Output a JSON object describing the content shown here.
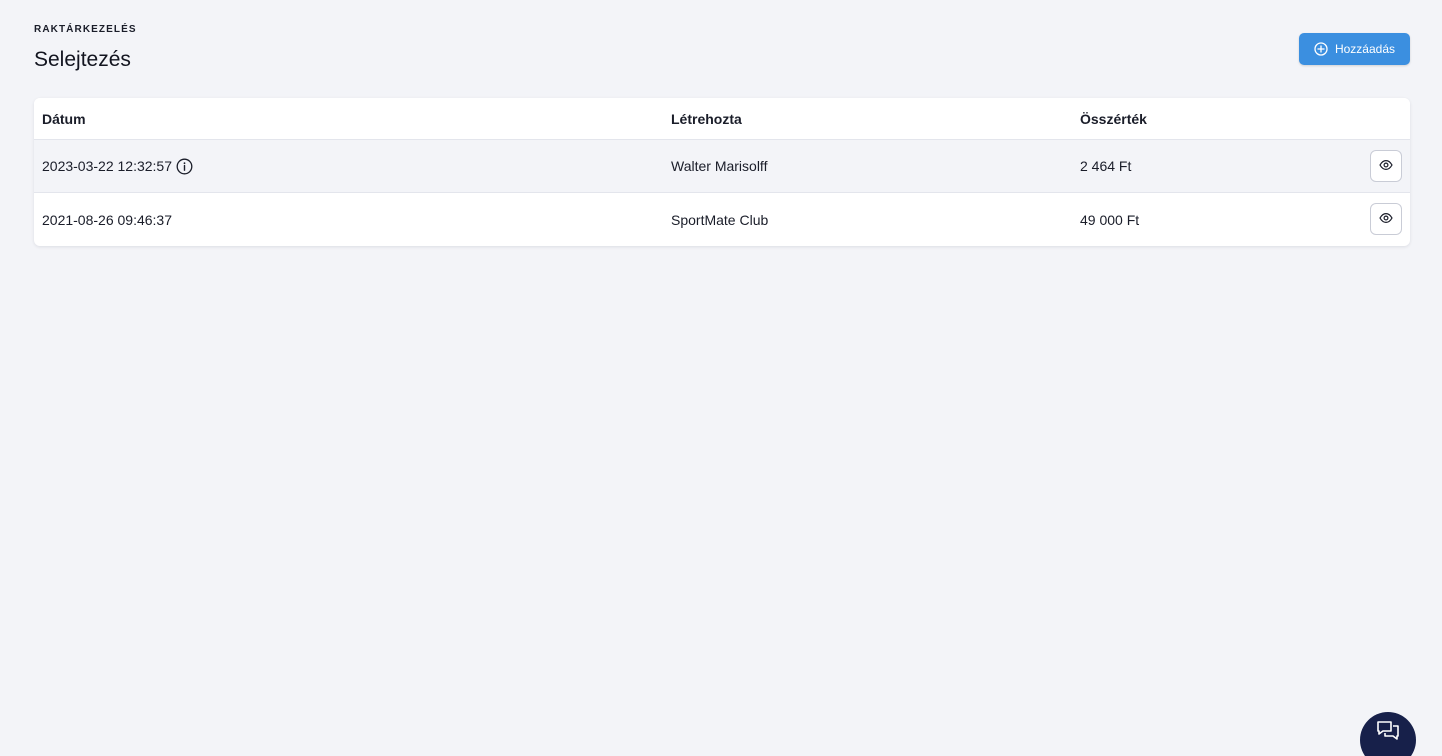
{
  "header": {
    "breadcrumb": "RAKTÁRKEZELÉS",
    "title": "Selejtezés"
  },
  "toolbar": {
    "add_label": "Hozzáadás"
  },
  "table": {
    "columns": {
      "date": "Dátum",
      "created_by": "Létrehozta",
      "total": "Összérték"
    },
    "rows": [
      {
        "date": "2023-03-22 12:32:57",
        "created_by": "Walter Marisolff",
        "total": "2 464 Ft",
        "has_info": true
      },
      {
        "date": "2021-08-26 09:46:37",
        "created_by": "SportMate Club",
        "total": "49 000 Ft",
        "has_info": false
      }
    ]
  },
  "icons": {
    "add": "plus-circle-icon",
    "info": "info-icon",
    "view": "eye-icon",
    "chat": "chat-bubbles-icon"
  },
  "colors": {
    "accent": "#3b8fe0",
    "background": "#f3f4f8",
    "fab": "#17204a"
  }
}
